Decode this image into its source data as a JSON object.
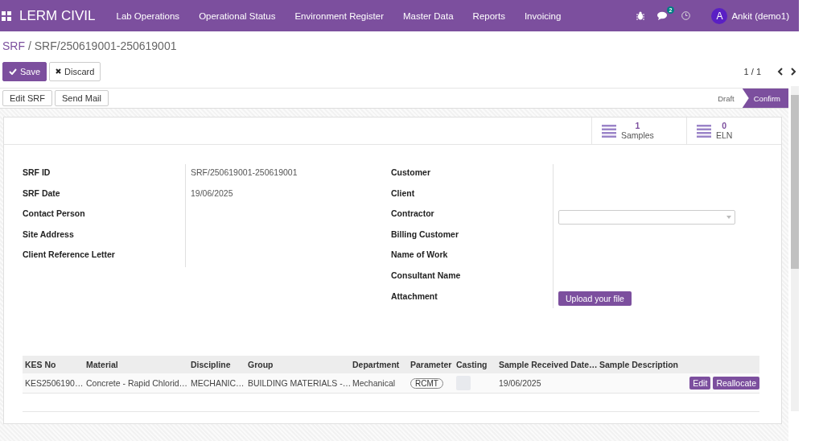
{
  "navbar": {
    "brand": "LERM CIVIL",
    "menus": [
      "Lab Operations",
      "Operational Status",
      "Environment Register",
      "Master Data",
      "Reports",
      "Invoicing"
    ],
    "chat_badge": "2",
    "avatar_letter": "A",
    "user": "Ankit (demo1)"
  },
  "breadcrumb": {
    "parent": "SRF",
    "current": "/ SRF/250619001-250619001"
  },
  "actions": {
    "save": "Save",
    "discard": "Discard"
  },
  "pager": "1 / 1",
  "header_buttons": [
    "Edit SRF",
    "Send Mail"
  ],
  "stages": [
    {
      "label": "Draft",
      "selected": false
    },
    {
      "label": "Confirm",
      "selected": true
    }
  ],
  "stat_buttons": [
    {
      "count": "1",
      "label": "Samples"
    },
    {
      "count": "0",
      "label": "ELN"
    }
  ],
  "left_fields": [
    {
      "label": "SRF ID",
      "value": "SRF/250619001-250619001"
    },
    {
      "label": "SRF Date",
      "value": "19/06/2025"
    },
    {
      "label": "Contact Person"
    },
    {
      "label": "Site Address"
    },
    {
      "label": "Client Reference Letter"
    }
  ],
  "right_fields": [
    {
      "label": "Customer",
      "kind": "plain"
    },
    {
      "label": "Client",
      "kind": "plain"
    },
    {
      "label": "Contractor",
      "kind": "select"
    },
    {
      "label": "Billing Customer",
      "kind": "plain"
    },
    {
      "label": "Name of Work",
      "kind": "plain"
    },
    {
      "label": "Consultant Name",
      "kind": "plain"
    },
    {
      "label": "Attachment",
      "kind": "upload",
      "button": "Upload your file"
    }
  ],
  "table": {
    "columns": [
      "KES No",
      "Material",
      "Discipline",
      "Group",
      "Department",
      "Parameter",
      "Casting",
      "Sample Received Date…",
      "Sample Description"
    ],
    "rows": [
      {
        "cells": [
          {
            "kind": "text",
            "text": "KES2506190…"
          },
          {
            "kind": "text",
            "text": "Concrete - Rapid Chlorid…"
          },
          {
            "kind": "text",
            "text": "MECHANIC…"
          },
          {
            "kind": "text",
            "text": "BUILDING MATERIALS -…"
          },
          {
            "kind": "text",
            "text": "Mechanical"
          },
          {
            "kind": "tag",
            "text": "RCMT"
          },
          {
            "kind": "box"
          },
          {
            "kind": "text",
            "text": "19/06/2025"
          },
          {
            "kind": "blank"
          }
        ],
        "buttons": [
          "Edit",
          "Reallocate"
        ]
      }
    ]
  }
}
